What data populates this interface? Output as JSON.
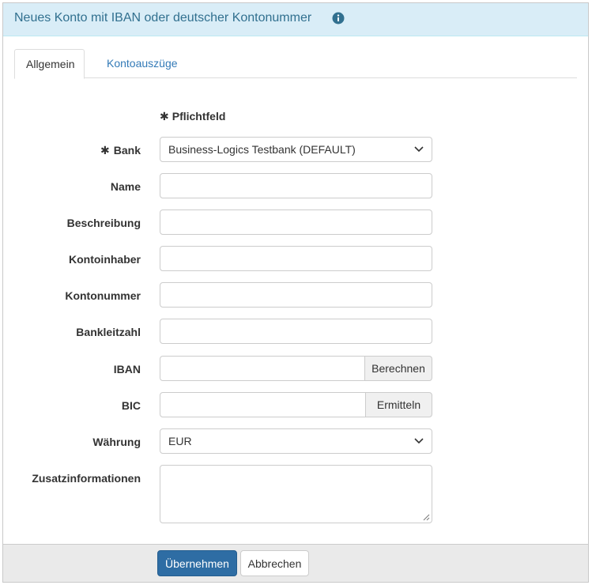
{
  "dialog": {
    "title": "Neues Konto mit IBAN oder deutscher Kontonummer",
    "info_icon": "info-circle-icon"
  },
  "tabs": [
    {
      "label": "Allgemein",
      "active": true
    },
    {
      "label": "Kontoauszüge",
      "active": false
    }
  ],
  "form": {
    "required_symbol": "✱",
    "required_note": "Pflichtfeld",
    "bank": {
      "label": "Bank",
      "value": "Business-Logics Testbank (DEFAULT)",
      "required": true
    },
    "name": {
      "label": "Name",
      "value": ""
    },
    "beschreibung": {
      "label": "Beschreibung",
      "value": ""
    },
    "kontoinhaber": {
      "label": "Kontoinhaber",
      "value": ""
    },
    "kontonummer": {
      "label": "Kontonummer",
      "value": ""
    },
    "bankleitzahl": {
      "label": "Bankleitzahl",
      "value": ""
    },
    "iban": {
      "label": "IBAN",
      "value": "",
      "button": "Berechnen"
    },
    "bic": {
      "label": "BIC",
      "value": "",
      "button": "Ermitteln"
    },
    "waehrung": {
      "label": "Währung",
      "value": "EUR"
    },
    "zusatz": {
      "label": "Zusatzinformationen",
      "value": ""
    }
  },
  "footer": {
    "submit_label": "Übernehmen",
    "cancel_label": "Abbrechen"
  },
  "colors": {
    "header_bg": "#d9edf7",
    "title": "#31708f",
    "link": "#337ab7",
    "primary": "#2e6da4"
  }
}
